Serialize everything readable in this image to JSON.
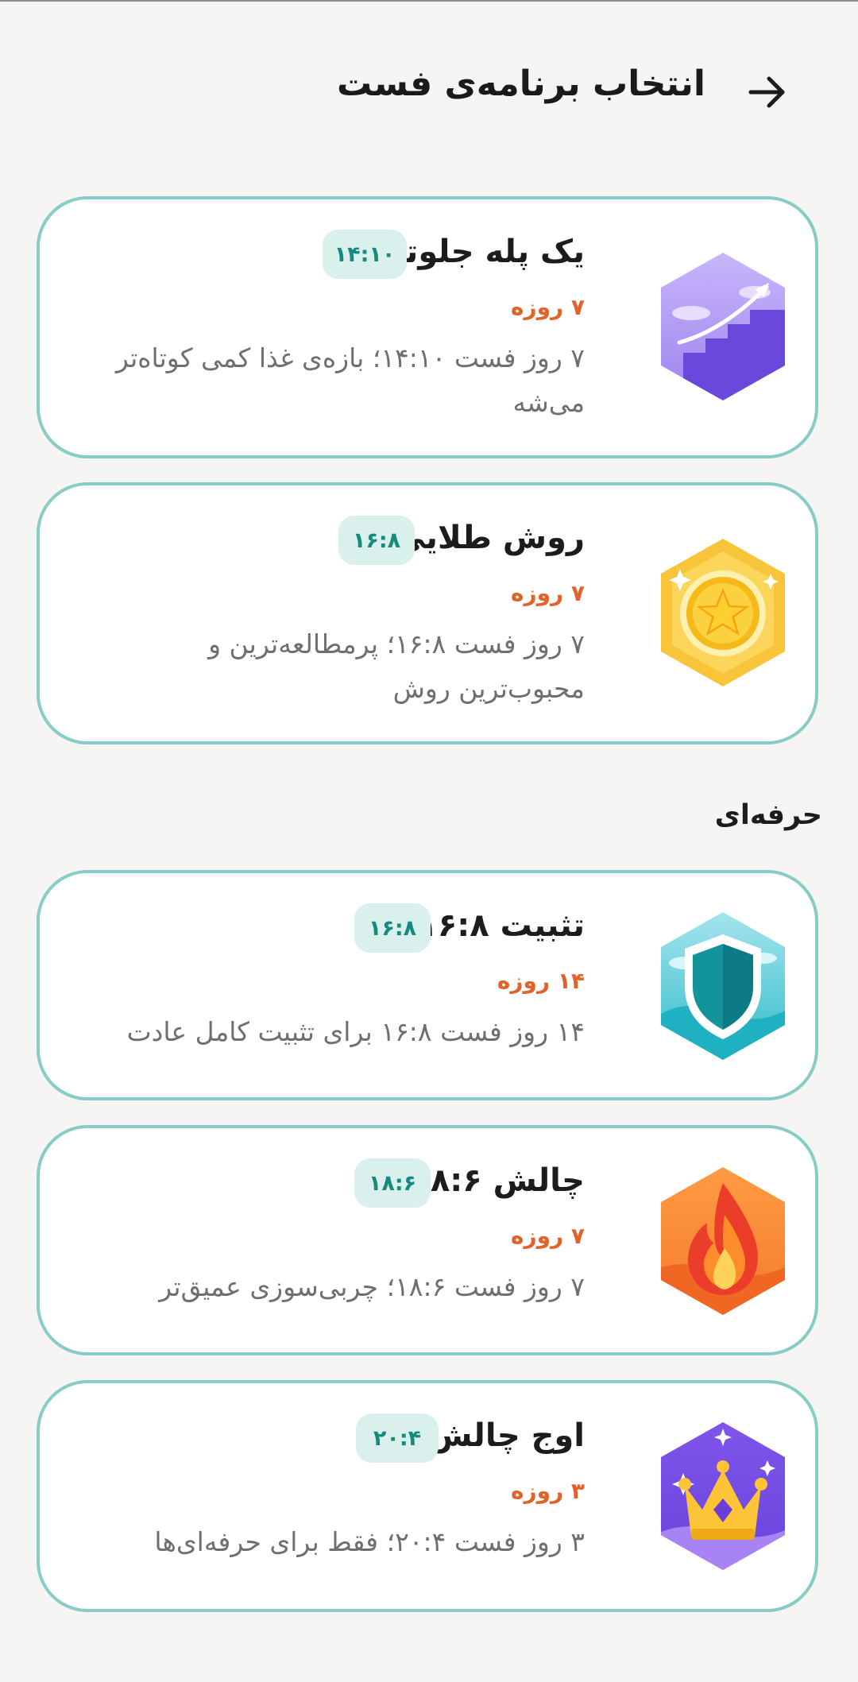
{
  "header": {
    "title": "انتخاب برنامه‌ی فست",
    "back_icon": "arrow-right-icon"
  },
  "section": {
    "title": "حرفه‌ای"
  },
  "plans": [
    {
      "title": "یک پله جلوتر",
      "chip": "۱۴:۱۰",
      "duration": "۷ روزه",
      "description": "۷ روز فست ۱۴:۱۰؛ بازه‌ی غذا کمی کوتاه‌تر می‌شه",
      "badge_icon": "stairs-up-icon",
      "badge_colors": [
        "#b8a4f5",
        "#6b4de0"
      ]
    },
    {
      "title": "روش طلایی",
      "chip": "۱۶:۸",
      "duration": "۷ روزه",
      "description": "۷ روز فست ۱۶:۸؛ پرمطالعه‌ترین و محبوب‌ترین روش",
      "badge_icon": "gold-star-medal-icon",
      "badge_colors": [
        "#ffd64d",
        "#f5b81e"
      ]
    },
    {
      "title": "تثبیت ۱۶:۸",
      "chip": "۱۶:۸",
      "duration": "۱۴ روزه",
      "description": "۱۴ روز فست ۱۶:۸ برای تثبیت کامل عادت",
      "badge_icon": "shield-icon",
      "badge_colors": [
        "#7fd6e6",
        "#27b5c6"
      ]
    },
    {
      "title": "چالش ۱۸:۶",
      "chip": "۱۸:۶",
      "duration": "۷ روزه",
      "description": "۷ روز فست ۱۸:۶؛ چربی‌سوزی عمیق‌تر",
      "badge_icon": "fire-icon",
      "badge_colors": [
        "#ff9a3d",
        "#f06a2a"
      ]
    },
    {
      "title": "اوج چالش",
      "chip": "۲۰:۴",
      "duration": "۳ روزه",
      "description": "۳ روز فست ۲۰:۴؛ فقط برای حرفه‌ای‌ها",
      "badge_icon": "crown-icon",
      "badge_colors": [
        "#8b5cf6",
        "#5b34d4"
      ]
    }
  ],
  "colors": {
    "accent_border": "#86cdc6",
    "chip_bg": "#d9f0ec",
    "chip_text": "#158a7d",
    "duration_text": "#e2622a",
    "page_bg": "#f6f5f3"
  }
}
